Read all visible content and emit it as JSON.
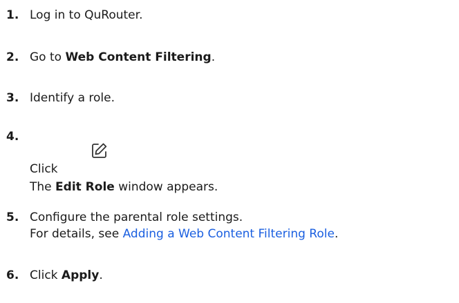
{
  "steps": [
    {
      "number": "1.",
      "text": "Log in to QuRouter."
    },
    {
      "number": "2.",
      "prefix": "Go to ",
      "bold": "Web Content Filtering",
      "suffix": "."
    },
    {
      "number": "3.",
      "text": "Identify a role."
    },
    {
      "number": "4.",
      "click_prefix": "Click",
      "click_suffix": ".",
      "icon": "edit-icon",
      "line2_prefix": "The ",
      "line2_bold": "Edit Role",
      "line2_suffix": " window appears."
    },
    {
      "number": "5.",
      "line1": "Configure the parental role settings.",
      "line2_prefix": "For details, see ",
      "link": "Adding a Web Content Filtering Role",
      "line2_suffix": "."
    },
    {
      "number": "6.",
      "prefix": "Click ",
      "bold": "Apply",
      "suffix": "."
    }
  ],
  "colors": {
    "link": "#1a5fe0",
    "text": "#1a1a1a"
  }
}
